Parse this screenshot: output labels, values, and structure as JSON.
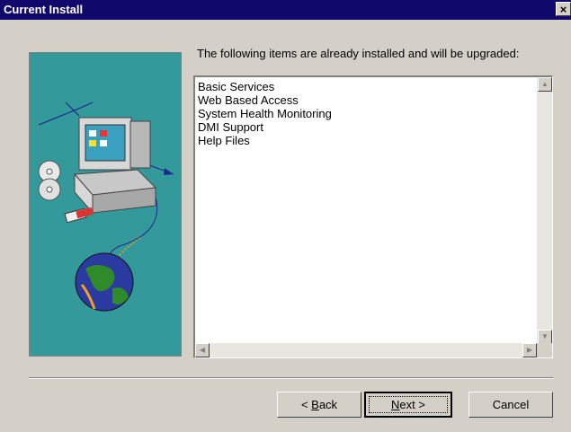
{
  "window": {
    "title": "Current Install",
    "close_label": "×"
  },
  "prompt": "The following items are already installed and will be upgraded:",
  "items": [
    "Basic Services",
    "Web Based Access",
    "System Health Monitoring",
    "DMI Support",
    "Help Files"
  ],
  "scrollbar_arrows": {
    "up": "▲",
    "down": "▼",
    "left": "◀",
    "right": "▶"
  },
  "buttons": {
    "back": {
      "prefix": "< ",
      "mnemonic": "B",
      "rest": "ack"
    },
    "next": {
      "mnemonic": "N",
      "rest": "ext >"
    },
    "cancel": "Cancel"
  },
  "colors": {
    "titlebar": "#10086b",
    "illustration_bg": "#33999a",
    "dialog_bg": "#d4d0c8"
  }
}
